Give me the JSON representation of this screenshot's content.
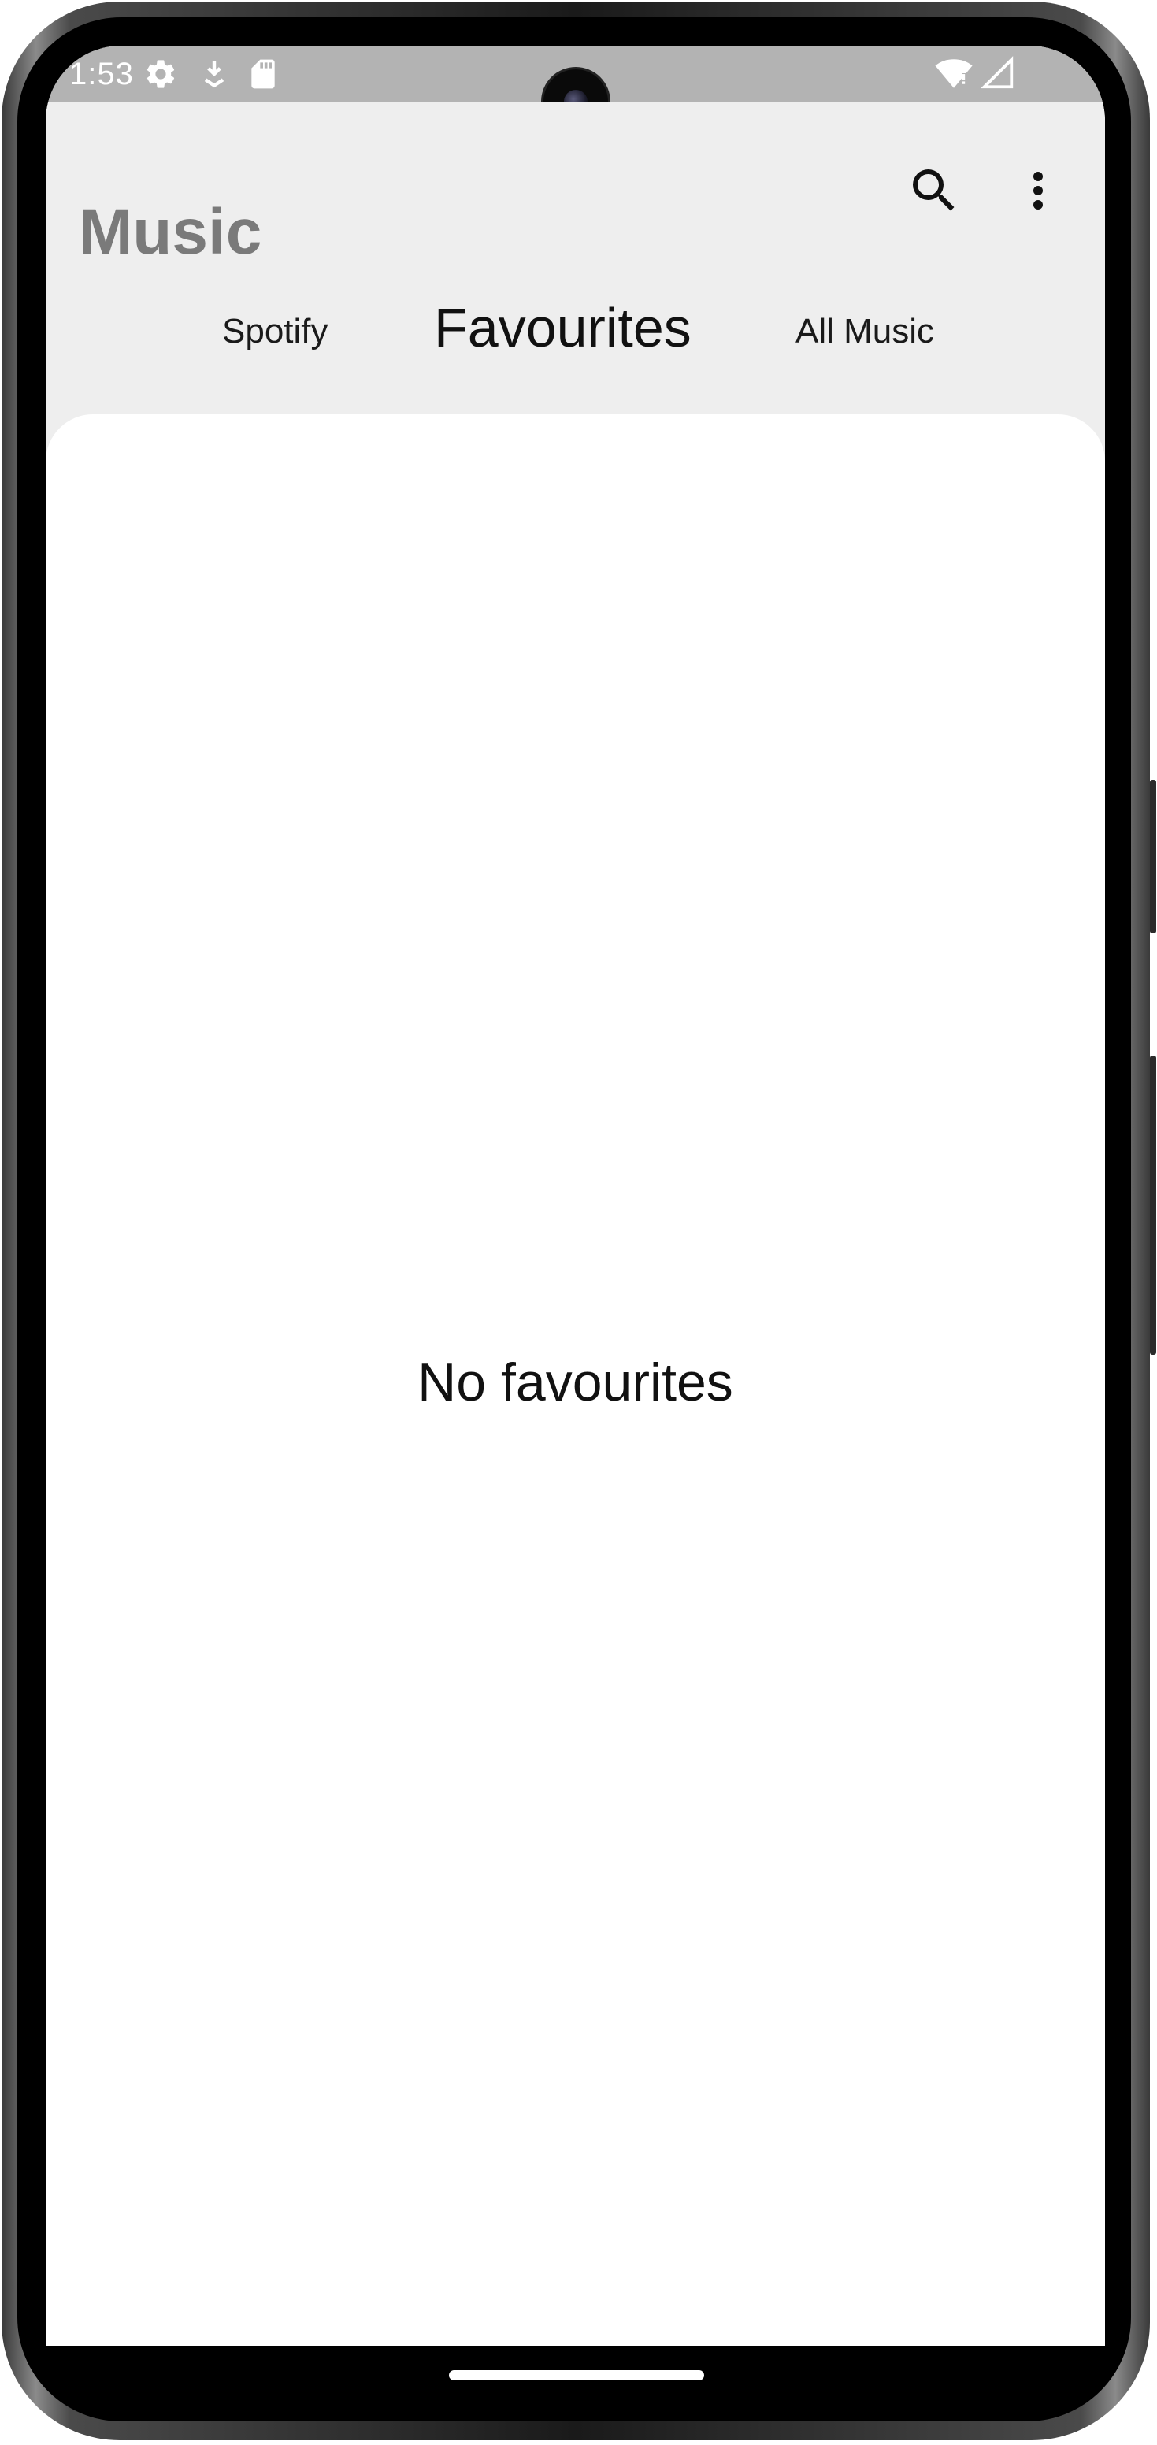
{
  "status_bar": {
    "time": "1:53",
    "icons": [
      "settings-gear-icon",
      "download-icon",
      "sd-card-icon",
      "wifi-icon",
      "cellular-signal-icon"
    ],
    "background": "#b3b3b3"
  },
  "app_bar": {
    "title": "Music",
    "actions": [
      "search-icon",
      "more-vert-icon"
    ],
    "background": "#eeeeee",
    "title_color": "#7a7a7a"
  },
  "tabs": {
    "items": [
      {
        "label": "Spotify",
        "active": false
      },
      {
        "label": "Favourites",
        "active": true
      },
      {
        "label": "All Music",
        "active": false
      }
    ]
  },
  "content": {
    "empty_message": "No favourites"
  }
}
